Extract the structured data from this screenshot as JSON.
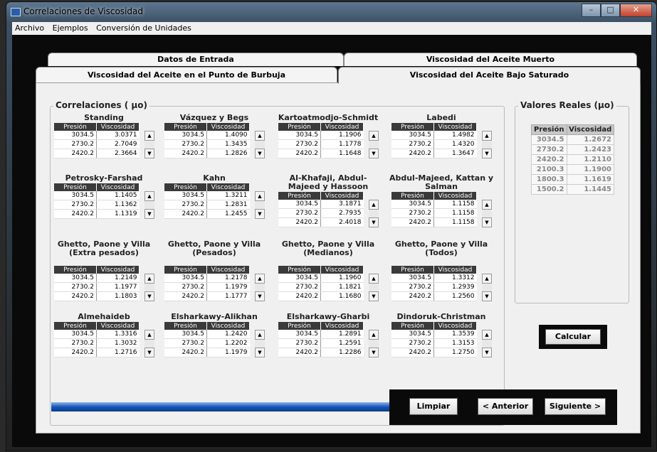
{
  "window": {
    "title": "Correlaciones de Viscosidad",
    "min": "–",
    "max": "□",
    "close": "✕"
  },
  "menu": [
    "Archivo",
    "Ejemplos",
    "Conversión de Unidades"
  ],
  "tabs": {
    "row1": [
      "Datos de Entrada",
      "Viscosidad del Aceite Muerto"
    ],
    "row2": [
      "Viscosidad del Aceite en el Punto de Burbuja",
      "Viscosidad del Aceite Bajo Saturado"
    ]
  },
  "correlaciones": {
    "legend": "Correlaciones ( μo)",
    "col_pres": "Presión",
    "col_visc": "Viscosidad",
    "items": [
      {
        "name": "Standing",
        "rows": [
          [
            "3034.5",
            "3.0371"
          ],
          [
            "2730.2",
            "2.7049"
          ],
          [
            "2420.2",
            "2.3664"
          ]
        ]
      },
      {
        "name": "Vázquez y Begs",
        "rows": [
          [
            "3034.5",
            "1.4090"
          ],
          [
            "2730.2",
            "1.3435"
          ],
          [
            "2420.2",
            "1.2826"
          ]
        ]
      },
      {
        "name": "Kartoatmodjo-Schmidt",
        "rows": [
          [
            "3034.5",
            "1.1906"
          ],
          [
            "2730.2",
            "1.1778"
          ],
          [
            "2420.2",
            "1.1648"
          ]
        ]
      },
      {
        "name": "Labedi",
        "rows": [
          [
            "3034.5",
            "1.4982"
          ],
          [
            "2730.2",
            "1.4320"
          ],
          [
            "2420.2",
            "1.3647"
          ]
        ]
      },
      {
        "name": "Petrosky-Farshad",
        "rows": [
          [
            "3034.5",
            "1.1405"
          ],
          [
            "2730.2",
            "1.1362"
          ],
          [
            "2420.2",
            "1.1319"
          ]
        ]
      },
      {
        "name": "Kahn",
        "rows": [
          [
            "3034.5",
            "1.3211"
          ],
          [
            "2730.2",
            "1.2831"
          ],
          [
            "2420.2",
            "1.2455"
          ]
        ]
      },
      {
        "name": "Al-Khafaji, Abdul-Majeed y Hassoon",
        "rows": [
          [
            "3034.5",
            "3.1871"
          ],
          [
            "2730.2",
            "2.7935"
          ],
          [
            "2420.2",
            "2.4018"
          ]
        ]
      },
      {
        "name": "Abdul-Majeed, Kattan y Salman",
        "rows": [
          [
            "3034.5",
            "1.1158"
          ],
          [
            "2730.2",
            "1.1158"
          ],
          [
            "2420.2",
            "1.1158"
          ]
        ]
      },
      {
        "name": "Ghetto, Paone y Villa (Extra pesados)",
        "rows": [
          [
            "3034.5",
            "1.2149"
          ],
          [
            "2730.2",
            "1.1977"
          ],
          [
            "2420.2",
            "1.1803"
          ]
        ]
      },
      {
        "name": "Ghetto, Paone y Villa (Pesados)",
        "rows": [
          [
            "3034.5",
            "1.2178"
          ],
          [
            "2730.2",
            "1.1979"
          ],
          [
            "2420.2",
            "1.1777"
          ]
        ]
      },
      {
        "name": "Ghetto, Paone y Villa (Medianos)",
        "rows": [
          [
            "3034.5",
            "1.1960"
          ],
          [
            "2730.2",
            "1.1821"
          ],
          [
            "2420.2",
            "1.1680"
          ]
        ]
      },
      {
        "name": "Ghetto, Paone y Villa (Todos)",
        "rows": [
          [
            "3034.5",
            "1.3312"
          ],
          [
            "2730.2",
            "1.2939"
          ],
          [
            "2420.2",
            "1.2560"
          ]
        ]
      },
      {
        "name": "Almehaideb",
        "rows": [
          [
            "3034.5",
            "1.3316"
          ],
          [
            "2730.2",
            "1.3032"
          ],
          [
            "2420.2",
            "1.2716"
          ]
        ]
      },
      {
        "name": "Elsharkawy-Alikhan",
        "rows": [
          [
            "3034.5",
            "1.2420"
          ],
          [
            "2730.2",
            "1.2202"
          ],
          [
            "2420.2",
            "1.1979"
          ]
        ]
      },
      {
        "name": "Elsharkawy-Gharbi",
        "rows": [
          [
            "3034.5",
            "1.2891"
          ],
          [
            "2730.2",
            "1.2591"
          ],
          [
            "2420.2",
            "1.2286"
          ]
        ]
      },
      {
        "name": "Dindoruk-Christman",
        "rows": [
          [
            "3034.5",
            "1.3539"
          ],
          [
            "2730.2",
            "1.3153"
          ],
          [
            "2420.2",
            "1.2750"
          ]
        ]
      }
    ]
  },
  "reales": {
    "legend": "Valores Reales (μo)",
    "col_pres": "Presión",
    "col_visc": "Viscosidad",
    "rows": [
      [
        "3034.5",
        "1.2672"
      ],
      [
        "2730.2",
        "1.2423"
      ],
      [
        "2420.2",
        "1.2110"
      ],
      [
        "2100.3",
        "1.1900"
      ],
      [
        "1800.3",
        "1.1619"
      ],
      [
        "1500.2",
        "1.1445"
      ]
    ]
  },
  "buttons": {
    "calcular": "Calcular",
    "limpiar": "Limpiar",
    "anterior": "< Anterior",
    "siguiente": "Siguiente >"
  },
  "scroll": {
    "up": "▲",
    "down": "▼"
  }
}
